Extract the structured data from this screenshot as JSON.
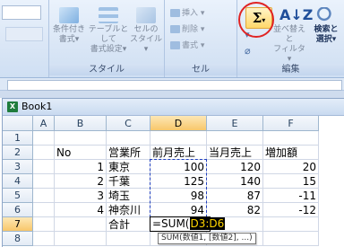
{
  "ribbon": {
    "groups": [
      {
        "label": "スタイル"
      },
      {
        "label": "セル"
      },
      {
        "label": "編集"
      }
    ],
    "style_buttons": [
      {
        "line1": "条件付き",
        "line2": "書式▾"
      },
      {
        "line1": "テーブルとして",
        "line2": "書式設定▾"
      },
      {
        "line1": "セルの",
        "line2": "スタイル▾"
      }
    ],
    "cell_buttons": [
      {
        "label": "挿入 ▾"
      },
      {
        "label": "削除 ▾"
      },
      {
        "label": "書式 ▾"
      }
    ],
    "edit": {
      "sigma": "Σ",
      "sort_line1": "並べ替えと",
      "sort_line2": "フィルタ▾",
      "find_line1": "検索と",
      "find_line2": "選択▾"
    }
  },
  "workbook": {
    "title": "Book1",
    "columns": [
      "A",
      "B",
      "C",
      "D",
      "E",
      "F"
    ],
    "rows": [
      "1",
      "2",
      "3",
      "4",
      "5",
      "6",
      "7",
      "8"
    ],
    "cells": {
      "B2": "No",
      "C2": "営業所",
      "D2": "前月売上",
      "E2": "当月売上",
      "F2": "増加額",
      "B3": "1",
      "C3": "東京",
      "D3": "100",
      "E3": "120",
      "F3": "20",
      "B4": "2",
      "C4": "千葉",
      "D4": "125",
      "E4": "140",
      "F4": "15",
      "B5": "3",
      "C5": "埼玉",
      "D5": "98",
      "E5": "87",
      "F5": "-11",
      "B6": "4",
      "C6": "神奈川",
      "D6": "94",
      "E6": "82",
      "F6": "-12",
      "C7": "合計"
    },
    "editing": {
      "prefix": "=SUM(",
      "ref": "D3:D6",
      "tooltip": "SUM(数値1, [数値2], ...)"
    }
  }
}
